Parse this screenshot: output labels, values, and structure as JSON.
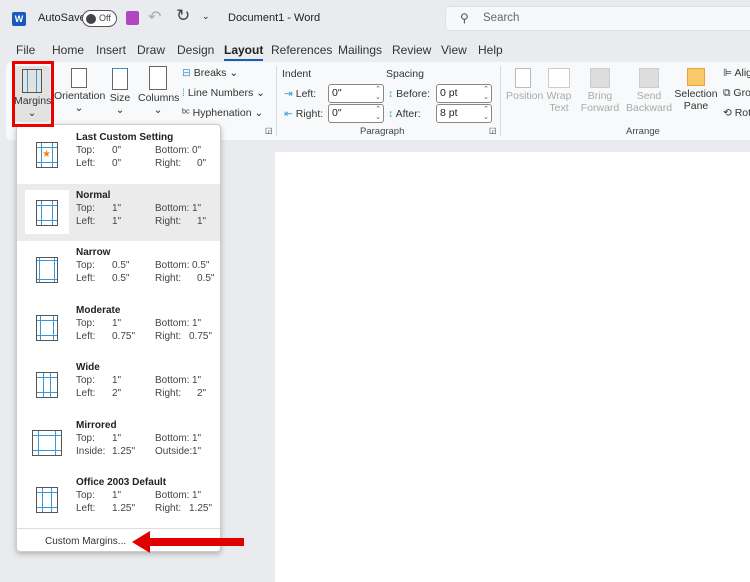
{
  "titlebar": {
    "app_icon": "word-icon",
    "autosave_label": "AutoSave",
    "autosave_state": "Off",
    "doc_title": "Document1  -  Word",
    "search_placeholder": "Search"
  },
  "tabs": [
    "File",
    "Home",
    "Insert",
    "Draw",
    "Design",
    "Layout",
    "References",
    "Mailings",
    "Review",
    "View",
    "Help"
  ],
  "active_tab": "Layout",
  "ribbon": {
    "margins": "Margins",
    "orientation": "Orientation",
    "size": "Size",
    "columns": "Columns",
    "breaks": "Breaks",
    "line_numbers": "Line Numbers",
    "hyphenation": "Hyphenation",
    "indent": "Indent",
    "spacing": "Spacing",
    "left": "Left:",
    "right": "Right:",
    "before": "Before:",
    "after": "After:",
    "indent_left": "0\"",
    "indent_right": "0\"",
    "space_before": "0 pt",
    "space_after": "8 pt",
    "paragraph_group": "Paragraph",
    "position": "Position",
    "wrap_text": "Wrap Text",
    "bring_forward": "Bring Forward",
    "send_backward": "Send Backward",
    "selection_pane": "Selection Pane",
    "align": "Alig",
    "group": "Gro",
    "rotate": "Rot",
    "arrange_group": "Arrange"
  },
  "margins_menu": {
    "items": [
      {
        "name": "Last Custom Setting",
        "k1": "Top:",
        "v1": "0\"",
        "k2": "Bottom:",
        "v2": "0\"",
        "k3": "Left:",
        "v3": "0\"",
        "k4": "Right:",
        "v4": "0\""
      },
      {
        "name": "Normal",
        "k1": "Top:",
        "v1": "1\"",
        "k2": "Bottom:",
        "v2": "1\"",
        "k3": "Left:",
        "v3": "1\"",
        "k4": "Right:",
        "v4": "1\""
      },
      {
        "name": "Narrow",
        "k1": "Top:",
        "v1": "0.5\"",
        "k2": "Bottom:",
        "v2": "0.5\"",
        "k3": "Left:",
        "v3": "0.5\"",
        "k4": "Right:",
        "v4": "0.5\""
      },
      {
        "name": "Moderate",
        "k1": "Top:",
        "v1": "1\"",
        "k2": "Bottom:",
        "v2": "1\"",
        "k3": "Left:",
        "v3": "0.75\"",
        "k4": "Right:",
        "v4": "0.75\""
      },
      {
        "name": "Wide",
        "k1": "Top:",
        "v1": "1\"",
        "k2": "Bottom:",
        "v2": "1\"",
        "k3": "Left:",
        "v3": "2\"",
        "k4": "Right:",
        "v4": "2\""
      },
      {
        "name": "Mirrored",
        "k1": "Top:",
        "v1": "1\"",
        "k2": "Bottom:",
        "v2": "1\"",
        "k3": "Inside:",
        "v3": "1.25\"",
        "k4": "Outside:",
        "v4": "1\""
      },
      {
        "name": "Office 2003 Default",
        "k1": "Top:",
        "v1": "1\"",
        "k2": "Bottom:",
        "v2": "1\"",
        "k3": "Left:",
        "v3": "1.25\"",
        "k4": "Right:",
        "v4": "1.25\""
      }
    ],
    "selected": "Normal",
    "custom": "Custom Margins..."
  },
  "annotation_color": "#e00000"
}
